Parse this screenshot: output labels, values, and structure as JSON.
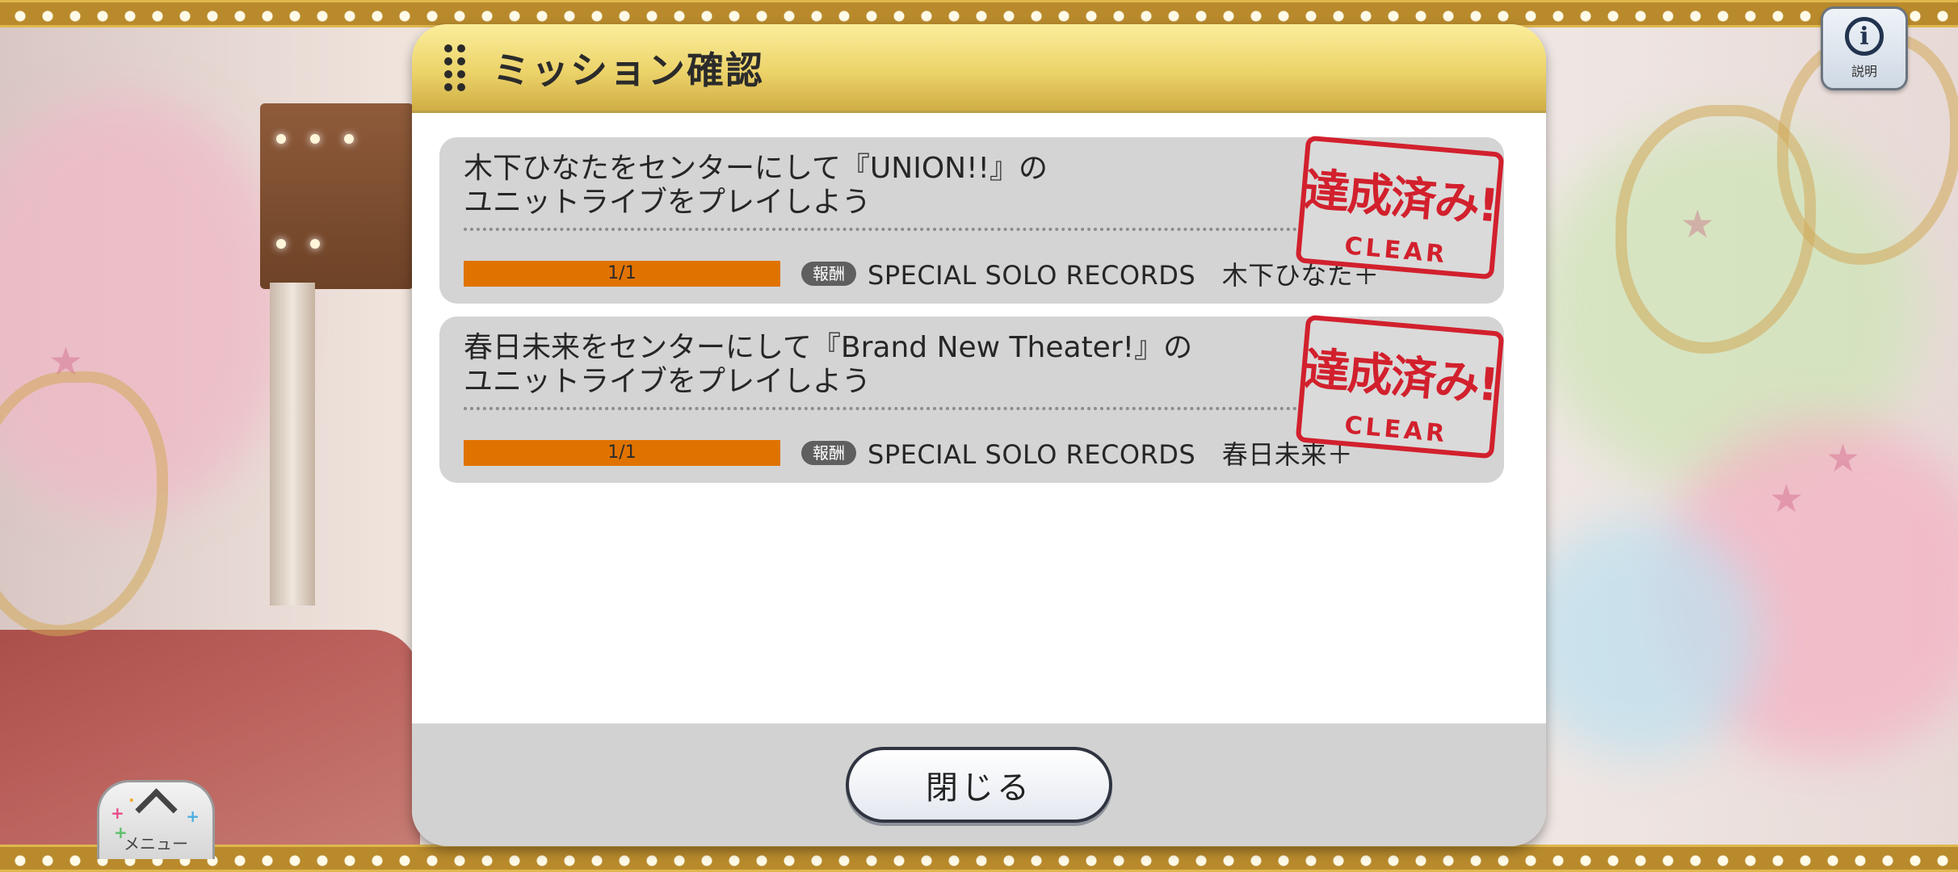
{
  "dialog": {
    "title": "ミッション確認",
    "close_label": "閉じる"
  },
  "missions": [
    {
      "line1": "木下ひなたをセンターにして『UNION!!』の",
      "line2": "ユニットライブをプレイしよう",
      "progress_text": "1/1",
      "progress": 1.0,
      "reward_badge": "報酬",
      "reward": "SPECIAL SOLO RECORDS　木下ひなた＋",
      "stamp_main": "達成済み!",
      "stamp_sub": "CLEAR"
    },
    {
      "line1": "春日未来をセンターにして『Brand New Theater!』の",
      "line2": "ユニットライブをプレイしよう",
      "progress_text": "1/1",
      "progress": 1.0,
      "reward_badge": "報酬",
      "reward": "SPECIAL SOLO RECORDS　春日未来＋",
      "stamp_main": "達成済み!",
      "stamp_sub": "CLEAR"
    }
  ],
  "info_button": {
    "label": "説明",
    "icon": "info-icon"
  },
  "menu_button": {
    "label": "メニュー",
    "icon": "chevron-up-icon"
  },
  "colors": {
    "progress_fill": "#e07300",
    "stamp": "#d2202d",
    "header_gold": "#ecd36a"
  }
}
